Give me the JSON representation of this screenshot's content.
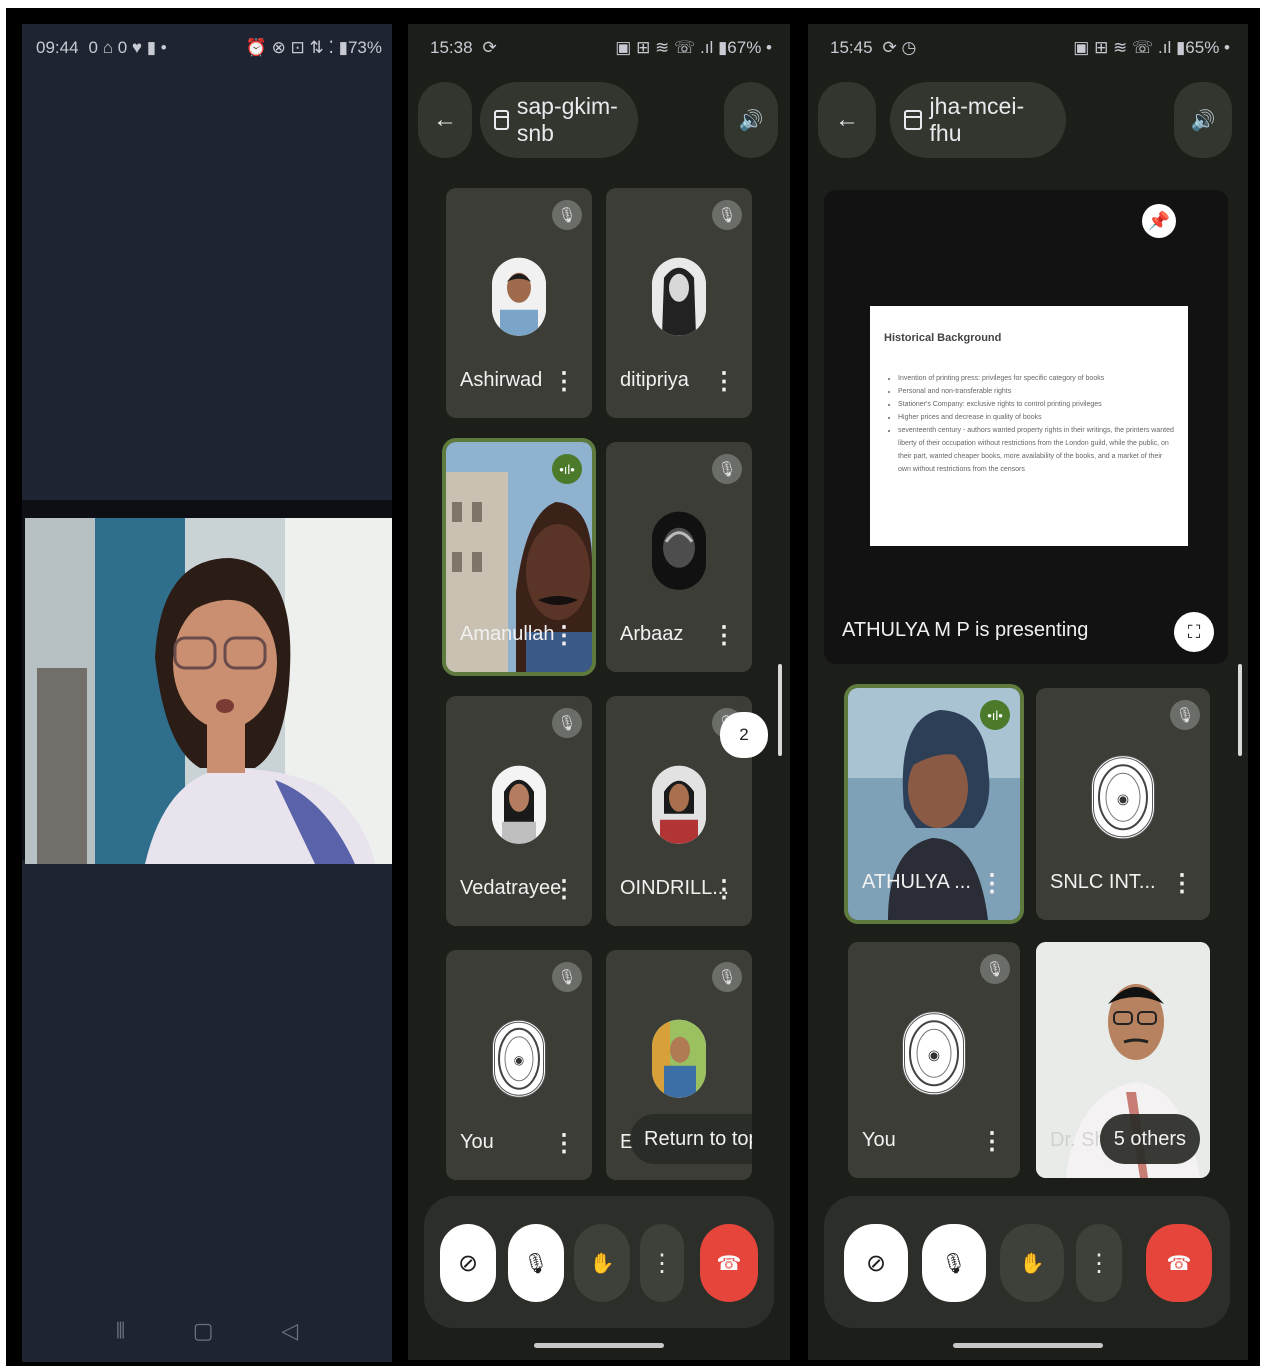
{
  "phone1": {
    "status": {
      "time": "09:44",
      "left_icons": "0 ⌂ 0 ♥ ▮ •",
      "right_icons": "⏰ ⊗ ⊡ ⇅ ⁚ ▮73%"
    },
    "nav": {
      "menu": "⫴",
      "home": "▢",
      "back": "◁"
    }
  },
  "phone2": {
    "status": {
      "time": "15:38",
      "left_icons": "⟳",
      "right_icons": "▣ ⊞ ≋ ☏ .ıl ▮67% •"
    },
    "meeting_code": "sap-gkim-snb",
    "back_icon": "←",
    "speaker_icon": "🔊",
    "participants": [
      {
        "name": "Ashirwad",
        "muted": true
      },
      {
        "name": "ditipriya",
        "muted": true
      },
      {
        "name": "Amanullah",
        "muted": false
      },
      {
        "name": "Arbaaz",
        "muted": true
      },
      {
        "name": "Vedatrayee",
        "muted": true
      },
      {
        "name": "OINDRILL...",
        "muted": true
      },
      {
        "name": "You",
        "muted": true
      },
      {
        "name": "E",
        "muted": true
      }
    ],
    "scroll_chip": "2",
    "return_to_top": "Return to top"
  },
  "phone3": {
    "status": {
      "time": "15:45",
      "left_icons": "⟳ ◷",
      "right_icons": "▣ ⊞ ≋ ☏ .ıl ▮65% •"
    },
    "meeting_code": "jha-mcei-fhu",
    "back_icon": "←",
    "speaker_icon": "🔊",
    "presentation": {
      "caption": "ATHULYA M P is presenting",
      "slide_title": "Historical Background",
      "slide_bullets": [
        "Invention of printing press: privileges for specific category of books",
        "Personal and non-transferable rights",
        "Stationer's Company: exclusive rights to control printing privileges",
        "Higher prices and decrease in quality of books",
        "seventeenth century - authors wanted property rights in their writings, the printers wanted liberty of their occupation without restrictions from the London guild, while the public, on their part, wanted cheaper books, more availability of the books, and a market of their own without restrictions from the censors"
      ]
    },
    "participants": [
      {
        "name": "ATHULYA ...",
        "muted": false
      },
      {
        "name": "SNLC INT...",
        "muted": true
      },
      {
        "name": "You",
        "muted": true
      },
      {
        "name": "Dr. Sh...",
        "muted": false
      }
    ],
    "others_label": "5 others"
  },
  "controls": {
    "camera_off": "⊘",
    "mic_off": "🎙",
    "raise_hand": "✋",
    "more": "⋮",
    "end_call": "☎"
  },
  "colors": {
    "meet_bg": "#1c1e1a",
    "tile": "#3b3d36",
    "end_call": "#e5453b",
    "speaking": "#5e7a3c"
  }
}
